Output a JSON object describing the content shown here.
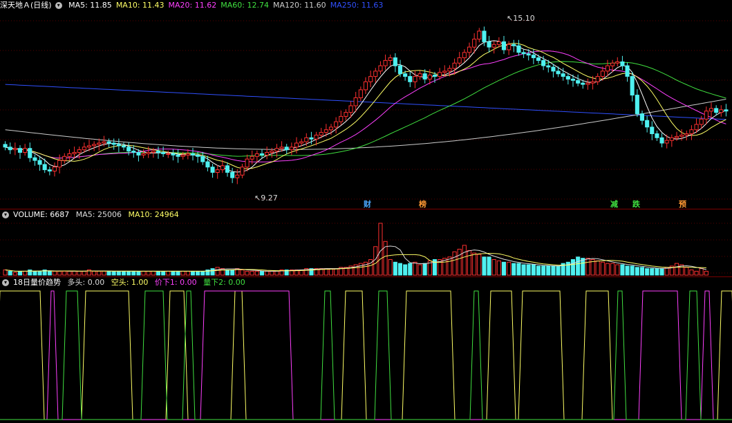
{
  "main_legend": {
    "stock": "深天地Ａ(日线)",
    "items": [
      {
        "label": "MA5: 11.85",
        "color": "#ffffff"
      },
      {
        "label": "MA10: 11.43",
        "color": "#ffff66"
      },
      {
        "label": "MA20: 11.62",
        "color": "#ff40ff"
      },
      {
        "label": "MA60: 12.74",
        "color": "#40e040"
      },
      {
        "label": "MA120: 11.60",
        "color": "#cccccc"
      },
      {
        "label": "MA250: 11.63",
        "color": "#3050ff"
      }
    ]
  },
  "price_annotations": {
    "high": "15.10",
    "low": "9.27"
  },
  "markers": [
    {
      "text": "财",
      "color": "#4aa8ff"
    },
    {
      "text": "榜",
      "color": "#ff9933"
    },
    {
      "text": "减",
      "color": "#40e040"
    },
    {
      "text": "跌",
      "color": "#40e040"
    },
    {
      "text": "预",
      "color": "#ff9933"
    }
  ],
  "volume_legend": {
    "title": "VOLUME: 6687",
    "items": [
      {
        "label": "MA5: 25006",
        "color": "#dddddd"
      },
      {
        "label": "MA10: 24964",
        "color": "#ffff66"
      }
    ]
  },
  "indicator_legend": {
    "title": "18日量价趋势",
    "items": [
      {
        "label": "多头: 0.00",
        "color": "#dddddd"
      },
      {
        "label": "空头: 1.00",
        "color": "#ffff66"
      },
      {
        "label": "价下1: 0.00",
        "color": "#ff40ff"
      },
      {
        "label": "量下2: 0.00",
        "color": "#40e040"
      }
    ]
  },
  "colors": {
    "up": "#ff3030",
    "down": "#4ff0f0",
    "grid": "#7a0000",
    "background": "#000000"
  },
  "chart_data": {
    "type": "candlestick",
    "price_range": [
      8.6,
      15.6
    ],
    "closes": [
      10.55,
      10.45,
      10.5,
      10.35,
      10.5,
      10.15,
      10.05,
      9.9,
      9.7,
      9.65,
      9.8,
      10.05,
      10.2,
      10.3,
      10.35,
      10.45,
      10.55,
      10.6,
      10.65,
      10.7,
      10.75,
      10.7,
      10.65,
      10.6,
      10.55,
      10.4,
      10.35,
      10.25,
      10.3,
      10.35,
      10.4,
      10.35,
      10.3,
      10.3,
      10.25,
      10.2,
      10.25,
      10.3,
      10.25,
      10.2,
      10.0,
      9.8,
      9.6,
      9.7,
      9.85,
      9.6,
      9.4,
      9.5,
      9.8,
      10.1,
      10.2,
      10.3,
      10.25,
      10.35,
      10.4,
      10.5,
      10.55,
      10.45,
      10.55,
      10.7,
      10.75,
      10.9,
      10.85,
      11.0,
      11.1,
      11.2,
      11.3,
      11.5,
      11.7,
      11.85,
      12.1,
      12.4,
      12.7,
      13.0,
      13.2,
      13.4,
      13.6,
      13.8,
      13.9,
      13.6,
      13.3,
      13.2,
      13.0,
      13.2,
      13.3,
      13.1,
      13.25,
      13.2,
      13.35,
      13.4,
      13.5,
      13.7,
      13.9,
      14.1,
      14.3,
      14.6,
      14.9,
      14.5,
      14.3,
      14.4,
      14.5,
      14.2,
      14.4,
      14.35,
      14.1,
      14.05,
      14.0,
      13.9,
      13.8,
      13.6,
      13.55,
      13.4,
      13.3,
      13.2,
      13.1,
      13.05,
      12.95,
      12.9,
      12.95,
      13.0,
      13.2,
      13.4,
      13.6,
      13.7,
      13.75,
      13.6,
      13.2,
      12.5,
      11.8,
      11.55,
      11.3,
      11.05,
      10.9,
      10.7,
      10.8,
      10.9,
      10.95,
      11.0,
      11.05,
      11.2,
      11.4,
      11.6,
      11.9,
      12.0,
      11.85,
      11.95,
      11.9
    ],
    "volumes": [
      4,
      3,
      2,
      3,
      3,
      4,
      3,
      3,
      4,
      3,
      3,
      3,
      3,
      3,
      3,
      3,
      3,
      4,
      3,
      3,
      3,
      3,
      3,
      3,
      3,
      3,
      3,
      3,
      3,
      3,
      3,
      3,
      3,
      3,
      3,
      3,
      3,
      3,
      3,
      3,
      3,
      4,
      5,
      6,
      5,
      4,
      4,
      5,
      4,
      3,
      3,
      3,
      3,
      3,
      3,
      3,
      4,
      4,
      4,
      4,
      4,
      5,
      5,
      5,
      5,
      5,
      5,
      5,
      6,
      6,
      7,
      8,
      9,
      10,
      12,
      22,
      40,
      26,
      12,
      10,
      9,
      8,
      9,
      10,
      8,
      9,
      11,
      12,
      12,
      13,
      14,
      18,
      20,
      23,
      19,
      17,
      16,
      14,
      14,
      12,
      11,
      10,
      10,
      9,
      9,
      8,
      8,
      8,
      7,
      7,
      7,
      7,
      7,
      9,
      10,
      12,
      14,
      13,
      13,
      12,
      11,
      10,
      9,
      9,
      8,
      8,
      7,
      7,
      6,
      6,
      5,
      5,
      5,
      5,
      6,
      7,
      9,
      8,
      6,
      4,
      3,
      5,
      3
    ]
  }
}
